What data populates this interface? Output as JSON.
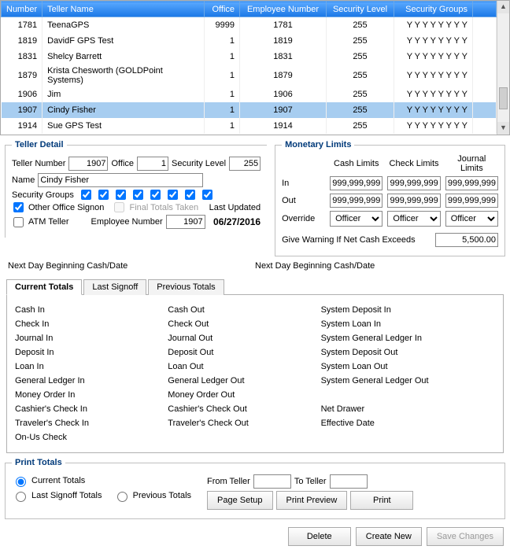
{
  "grid": {
    "headers": {
      "number": "Number",
      "teller_name": "Teller Name",
      "office": "Office",
      "employee_number": "Employee Number",
      "security_level": "Security Level",
      "security_groups": "Security Groups"
    },
    "rows": [
      {
        "number": "1781",
        "name": "TeenaGPS",
        "office": "9999",
        "emp": "1781",
        "sec_level": "255",
        "sec_groups": "Y Y Y Y Y Y Y Y"
      },
      {
        "number": "1819",
        "name": "DavidF GPS Test",
        "office": "1",
        "emp": "1819",
        "sec_level": "255",
        "sec_groups": "Y Y Y Y Y Y Y Y"
      },
      {
        "number": "1831",
        "name": "Shelcy Barrett",
        "office": "1",
        "emp": "1831",
        "sec_level": "255",
        "sec_groups": "Y Y Y Y Y Y Y Y"
      },
      {
        "number": "1879",
        "name": "Krista Chesworth (GOLDPoint Systems)",
        "office": "1",
        "emp": "1879",
        "sec_level": "255",
        "sec_groups": "Y Y Y Y Y Y Y Y"
      },
      {
        "number": "1906",
        "name": "Jim",
        "office": "1",
        "emp": "1906",
        "sec_level": "255",
        "sec_groups": "Y Y Y Y Y Y Y Y"
      },
      {
        "number": "1907",
        "name": "Cindy Fisher",
        "office": "1",
        "emp": "1907",
        "sec_level": "255",
        "sec_groups": "Y Y Y Y Y Y Y Y",
        "selected": true
      },
      {
        "number": "1914",
        "name": "Sue GPS Test",
        "office": "1",
        "emp": "1914",
        "sec_level": "255",
        "sec_groups": "Y Y Y Y Y Y Y Y"
      }
    ]
  },
  "detail": {
    "legend": "Teller Detail",
    "labels": {
      "teller_number": "Teller Number",
      "office": "Office",
      "security_level": "Security Level",
      "name": "Name",
      "security_groups": "Security Groups",
      "other_office": "Other Office Signon",
      "final_totals": "Final Totals Taken",
      "last_updated": "Last Updated",
      "atm_teller": "ATM Teller",
      "employee_number": "Employee Number",
      "next_day_left": "Next Day Beginning Cash/Date",
      "next_day_right": "Next Day Beginning Cash/Date"
    },
    "values": {
      "teller_number": "1907",
      "office": "1",
      "security_level": "255",
      "name": "Cindy Fisher",
      "employee_number": "1907",
      "last_updated": "06/27/2016",
      "other_office_checked": true,
      "final_totals_checked": false,
      "atm_teller_checked": false,
      "sec_group_checks": [
        true,
        true,
        true,
        true,
        true,
        true,
        true,
        true
      ]
    }
  },
  "monetary": {
    "legend": "Monetary Limits",
    "headers": {
      "cash": "Cash Limits",
      "check": "Check Limits",
      "journal": "Journal Limits"
    },
    "rows": {
      "in": {
        "label": "In",
        "cash": "999,999,999",
        "check": "999,999,999",
        "journal": "999,999,999"
      },
      "out": {
        "label": "Out",
        "cash": "999,999,999",
        "check": "999,999,999",
        "journal": "999,999,999"
      },
      "override": {
        "label": "Override",
        "cash": "Officer",
        "check": "Officer",
        "journal": "Officer"
      }
    },
    "warning_label": "Give Warning If Net Cash Exceeds",
    "warning_value": "5,500.00"
  },
  "tabs": {
    "items": [
      {
        "label": "Current Totals",
        "active": true
      },
      {
        "label": "Last Signoff",
        "active": false
      },
      {
        "label": "Previous Totals",
        "active": false
      }
    ],
    "cols": {
      "left": [
        "Cash In",
        "Check In",
        "Journal In",
        "Deposit In",
        "Loan In",
        "General Ledger In",
        "Money Order In",
        "Cashier's Check In",
        "Traveler's Check In",
        "On-Us Check"
      ],
      "mid": [
        "Cash Out",
        "Check Out",
        "Journal Out",
        "Deposit Out",
        "Loan Out",
        "General Ledger Out",
        "Money Order Out",
        "Cashier's Check Out",
        "Traveler's Check Out"
      ],
      "right": [
        "System Deposit In",
        "System Loan In",
        "System General Ledger In",
        "System Deposit Out",
        "System Loan Out",
        "System General Ledger Out",
        "",
        "Net Drawer",
        "Effective Date"
      ]
    }
  },
  "print": {
    "legend": "Print Totals",
    "options": {
      "current": "Current Totals",
      "last_signoff": "Last Signoff Totals",
      "previous": "Previous Totals"
    },
    "selected": "current",
    "from_label": "From Teller",
    "to_label": "To Teller",
    "from_value": "",
    "to_value": "",
    "buttons": {
      "page_setup": "Page Setup",
      "preview": "Print Preview",
      "print": "Print"
    }
  },
  "bottom": {
    "delete": "Delete",
    "create_new": "Create New",
    "save_changes": "Save Changes"
  }
}
